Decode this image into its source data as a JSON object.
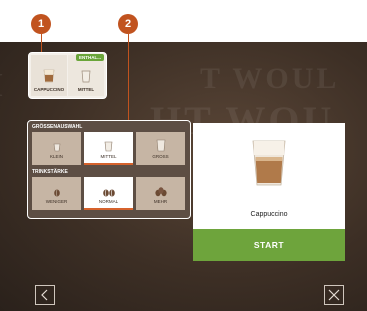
{
  "background_text": [
    "T WOUL",
    "HT WOU"
  ],
  "markers": [
    {
      "label": "1"
    },
    {
      "label": "2"
    }
  ],
  "summary": {
    "product_label": "CAPPUCCINO",
    "size_label": "MITTEL",
    "badge": "ENTHAL..."
  },
  "size_section": {
    "title": "GRÖSSENAUSWAHL",
    "options": [
      {
        "label": "KLEIN",
        "selected": false
      },
      {
        "label": "MITTEL",
        "selected": true
      },
      {
        "label": "GROSS",
        "selected": false
      }
    ]
  },
  "strength_section": {
    "title": "TRINKSTÄRKE",
    "options": [
      {
        "label": "WENIGER",
        "selected": false
      },
      {
        "label": "NORMAL",
        "selected": true
      },
      {
        "label": "MEHR",
        "selected": false
      }
    ]
  },
  "product": {
    "name": "Cappuccino"
  },
  "start_button": {
    "label": "START"
  },
  "nav": {
    "back_icon": "chevron-left-icon",
    "close_icon": "close-icon"
  },
  "colors": {
    "marker": "#c1531f",
    "start": "#6ea43c",
    "badge": "#6aa53a",
    "selected_underline": "#d6622c"
  }
}
